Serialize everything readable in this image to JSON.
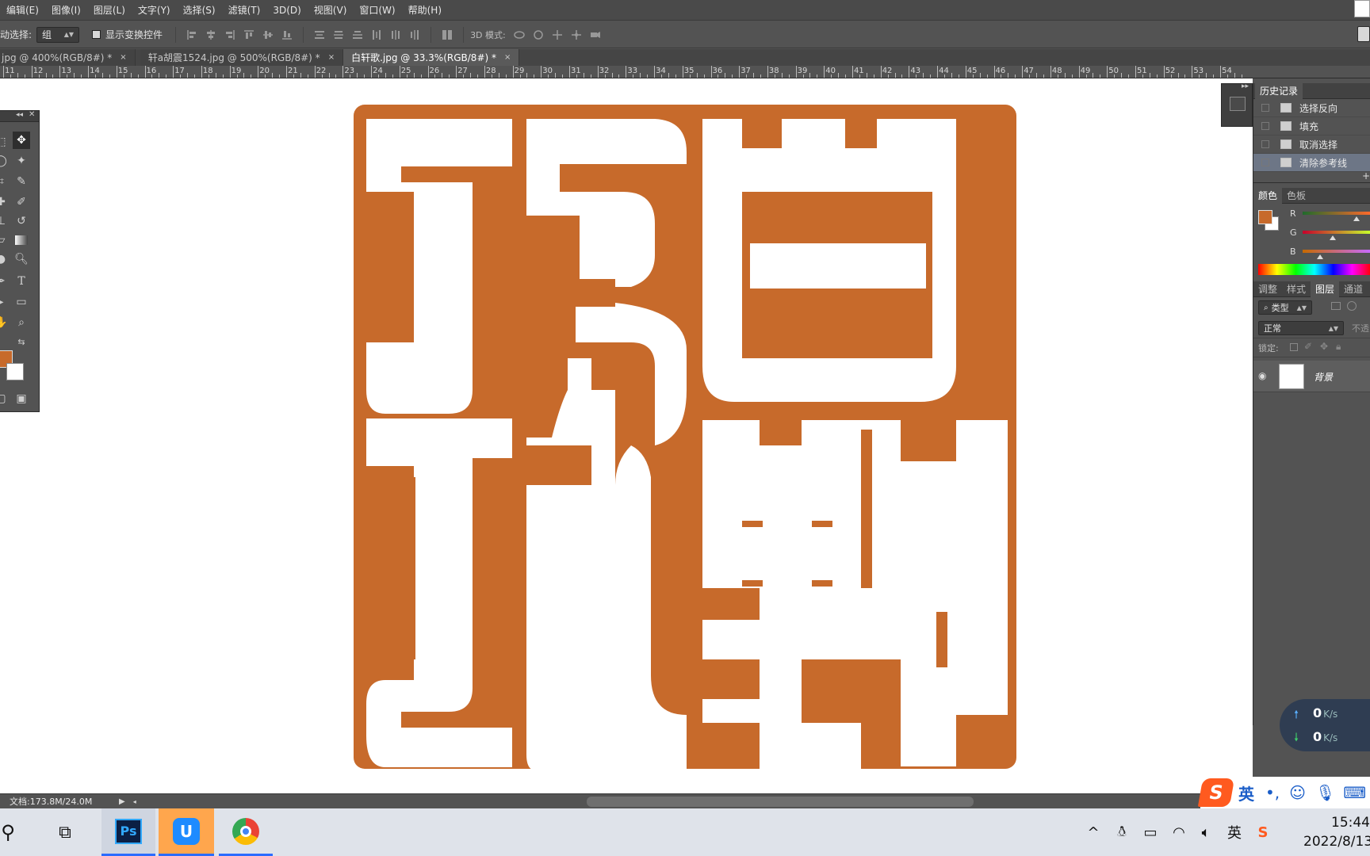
{
  "menu": {
    "items": [
      "编辑(E)",
      "图像(I)",
      "图层(L)",
      "文字(Y)",
      "选择(S)",
      "滤镜(T)",
      "3D(D)",
      "视图(V)",
      "窗口(W)",
      "帮助(H)"
    ]
  },
  "options": {
    "auto_select_label": "动选择:",
    "auto_select_value": "组",
    "show_transform_label": "显示变换控件",
    "mode_3d_label": "3D 模式:"
  },
  "tabs": [
    {
      "label": "jpg @ 400%(RGB/8#) *",
      "close": "×"
    },
    {
      "label": "轩a胡震1524.jpg @ 500%(RGB/8#) *",
      "close": "×"
    },
    {
      "label": "白轩歌.jpg @ 33.3%(RGB/8#) *",
      "close": "×"
    }
  ],
  "ruler": [
    "11",
    "12",
    "13",
    "14",
    "15",
    "16",
    "17",
    "18",
    "19",
    "20",
    "21",
    "22",
    "23",
    "24",
    "25",
    "26",
    "27",
    "28",
    "29",
    "30",
    "31",
    "32",
    "33",
    "34",
    "35",
    "36",
    "37",
    "38",
    "39",
    "40",
    "41",
    "42",
    "43",
    "44",
    "45",
    "46",
    "47",
    "48",
    "49",
    "50",
    "51",
    "52",
    "53",
    "54"
  ],
  "history": {
    "tab_label": "历史记录",
    "rows": [
      {
        "label": "选择反向",
        "selected": false
      },
      {
        "label": "填充",
        "selected": false
      },
      {
        "label": "取消选择",
        "selected": false
      },
      {
        "label": "清除参考线",
        "selected": true
      }
    ]
  },
  "color_panel": {
    "tabs": [
      "颜色",
      "色板"
    ],
    "channels": [
      "R",
      "G",
      "B"
    ],
    "foreground": "#c76a2b",
    "background": "#ffffff"
  },
  "layers_panel": {
    "tabs": [
      "调整",
      "样式",
      "图层",
      "通道"
    ],
    "filter_label": "类型",
    "blend_mode": "正常",
    "opacity_label": "不透",
    "lock_label": "锁定:",
    "layer_name": "背景"
  },
  "status": {
    "doc_info": "文档:173.8M/24.0M"
  },
  "netspeed": {
    "up": "0",
    "down": "0",
    "unit": "K/s"
  },
  "ime": {
    "lang": "英"
  },
  "taskbar": {
    "tray_lang": "英",
    "time": "15:44",
    "date": "2022/8/13"
  },
  "colors": {
    "seal": "#c76a2b",
    "accent": "#ffa64d"
  }
}
